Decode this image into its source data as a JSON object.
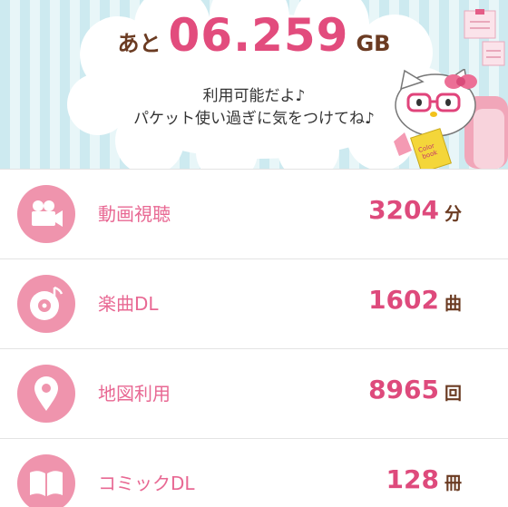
{
  "header": {
    "remain_prefix": "あと",
    "remain_value": "06.259",
    "remain_unit": "GB",
    "message_line1": "利用可能だよ♪",
    "message_line2": "パケット使い過ぎに気をつけてね♪",
    "book_text": "Color book"
  },
  "rows": [
    {
      "label": "動画視聴",
      "value": "3204",
      "unit": "分",
      "icon": "video-camera-icon"
    },
    {
      "label": "楽曲DL",
      "value": "1602",
      "unit": "曲",
      "icon": "music-disc-icon"
    },
    {
      "label": "地図利用",
      "value": "8965",
      "unit": "回",
      "icon": "map-pin-icon"
    },
    {
      "label": "コミックDL",
      "value": "128",
      "unit": "冊",
      "icon": "open-book-icon"
    }
  ],
  "colors": {
    "accent_pink": "#de4a7c",
    "icon_pink": "#ef94ad",
    "label_pink": "#e86893",
    "brown": "#6b3b22",
    "stripe_blue": "#cdeaf0"
  }
}
